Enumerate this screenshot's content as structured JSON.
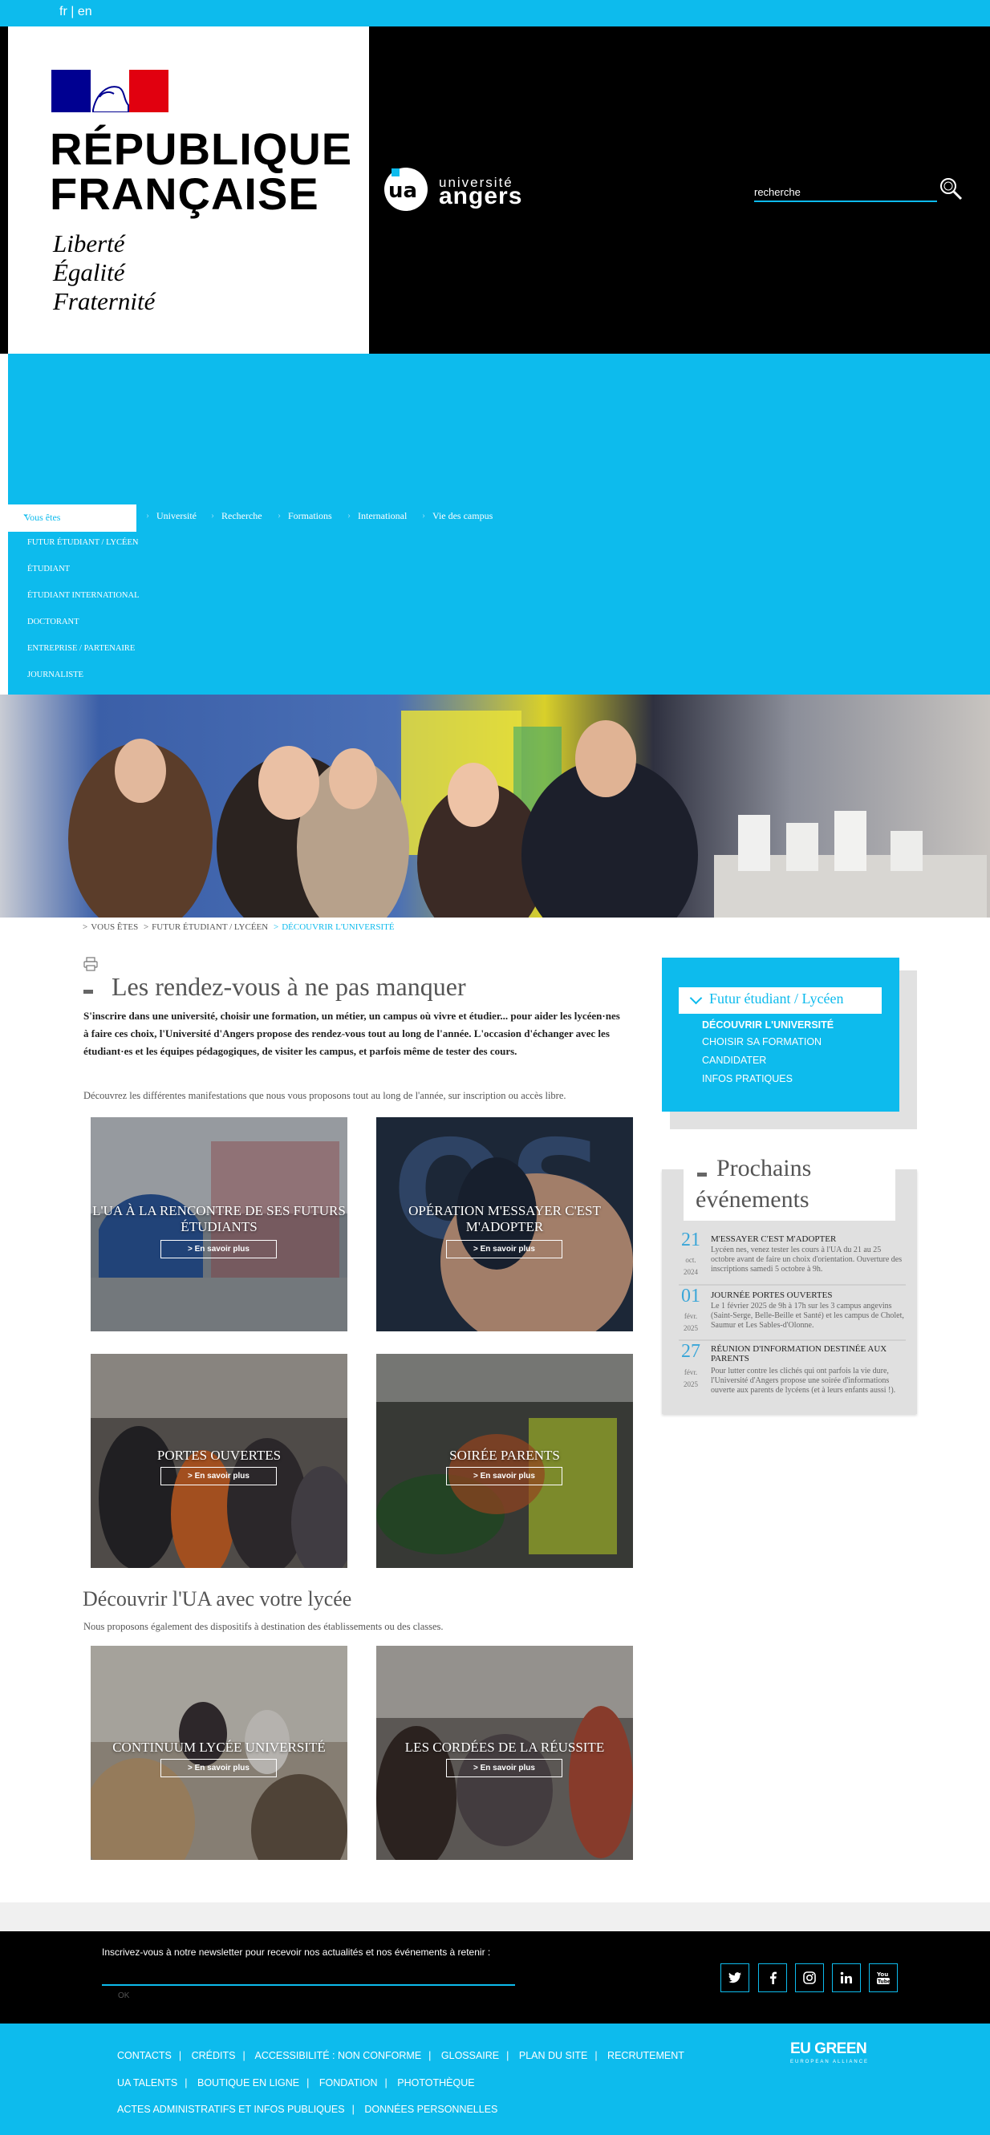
{
  "lang": {
    "fr": "fr",
    "sep": "|",
    "en": "en"
  },
  "header": {
    "rf_line1": "RÉPUBLIQUE",
    "rf_line2": "FRANÇAISE",
    "motto1": "Liberté",
    "motto2": "Égalité",
    "motto3": "Fraternité",
    "ua_small": "université",
    "ua_big": "angers",
    "search_placeholder": "recherche"
  },
  "nav": {
    "vous_etes": "Vous êtes",
    "sub_items": [
      "FUTUR ÉTUDIANT / LYCÉEN",
      "ÉTUDIANT",
      "ÉTUDIANT INTERNATIONAL",
      "DOCTORANT",
      "ENTREPRISE / PARTENAIRE",
      "JOURNALISTE"
    ],
    "main": [
      "Université",
      "Recherche",
      "Formations",
      "International",
      "Vie des campus"
    ]
  },
  "breadcrumb": [
    "VOUS ÊTES",
    "FUTUR ÉTUDIANT / LYCÉEN",
    "DÉCOUVRIR L'UNIVERSITÉ"
  ],
  "main": {
    "title": "Les rendez-vous à ne pas manquer",
    "intro": "S'inscrire dans une université, choisir une formation, un métier, un campus où vivre et étudier... pour aider les lycéen·nes à faire ces choix, l'Université d'Angers propose des rendez-vous tout au long de l'année. L'occasion d'échanger avec les étudiant·es et les équipes pédagogiques, de visiter les campus, et parfois même de tester des cours.",
    "intro2": "Découvrez les différentes manifestations que nous vous proposons tout au long de l'année, sur inscription ou accès libre.",
    "cards": [
      {
        "title": "L'UA À LA RENCONTRE DE SES FUTURS ÉTUDIANTS",
        "btn": "> En savoir plus"
      },
      {
        "title": "OPÉRATION M'ESSAYER C'EST M'ADOPTER",
        "btn": "> En savoir plus"
      },
      {
        "title": "PORTES OUVERTES",
        "btn": "> En savoir plus"
      },
      {
        "title": "SOIRÉE PARENTS",
        "btn": "> En savoir plus"
      }
    ],
    "section2_title": "Découvrir l'UA avec votre lycée",
    "section2_sub": "Nous proposons également des dispositifs à destination des établissements ou des classes.",
    "cards2": [
      {
        "title": "CONTINUUM LYCÉE UNIVERSITÉ",
        "btn": "> En savoir plus"
      },
      {
        "title": "LES CORDÉES DE LA RÉUSSITE",
        "btn": "> En savoir plus"
      }
    ]
  },
  "sidebar": {
    "box_title": "Futur étudiant / Lycéen",
    "links": [
      "DÉCOUVRIR L'UNIVERSITÉ",
      "CHOISIR SA FORMATION",
      "CANDIDATER",
      "INFOS PRATIQUES"
    ],
    "events_title1": "Prochains",
    "events_title2": "événements",
    "events": [
      {
        "day": "21",
        "mon": "oct.",
        "year": "2024",
        "title": "M'ESSAYER C'EST M'ADOPTER",
        "desc": "Lycéen nes, venez tester les cours à l'UA du 21 au 25 octobre avant de faire un choix d'orientation. Ouverture des inscriptions samedi 5 octobre à 9h."
      },
      {
        "day": "01",
        "mon": "févr.",
        "year": "2025",
        "title": "JOURNÉE PORTES OUVERTES",
        "desc": "Le 1 février 2025 de 9h à 17h sur les 3 campus angevins (Saint-Serge, Belle-Beille et Santé) et les campus de Cholet, Saumur et Les Sables-d'Olonne."
      },
      {
        "day": "27",
        "mon": "févr.",
        "year": "2025",
        "title": "RÉUNION D'INFORMATION DESTINÉE AUX PARENTS",
        "desc": "Pour lutter contre les clichés qui ont parfois la vie dure, l'Université d'Angers propose une soirée d'informations ouverte aux parents de lycéens (et à leurs enfants aussi !)."
      }
    ]
  },
  "newsletter": {
    "text": "Inscrivez-vous à notre newsletter pour recevoir nos actualités et nos événements à retenir :",
    "ok": "OK"
  },
  "social": [
    "twitter-icon",
    "facebook-icon",
    "instagram-icon",
    "linkedin-icon",
    "youtube-icon"
  ],
  "footer": {
    "row1": [
      "CONTACTS",
      "CRÉDITS",
      "ACCESSIBILITÉ : NON CONFORME",
      "GLOSSAIRE",
      "PLAN DU SITE",
      "RECRUTEMENT"
    ],
    "row2": [
      "UA TALENTS",
      "BOUTIQUE EN LIGNE",
      "FONDATION",
      "PHOTOTHÈQUE"
    ],
    "row3": [
      "ACTES ADMINISTRATIFS ET INFOS PUBLIQUES",
      "DONNÉES PERSONNELLES"
    ],
    "eu_green": "EU GREEN",
    "eu_green_sub": "EUROPEAN ALLIANCE"
  },
  "colors": {
    "accent": "#0dbbed",
    "black": "#000000"
  }
}
